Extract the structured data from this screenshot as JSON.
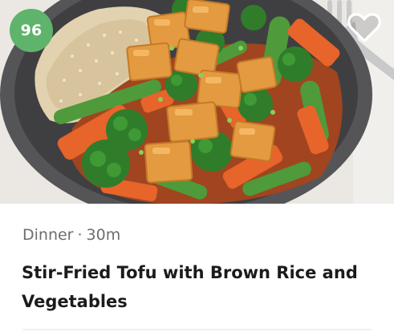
{
  "card": {
    "score": "96",
    "category": "Dinner",
    "separator": "·",
    "duration": "30m",
    "title": "Stir-Fried Tofu with Brown Rice and Vegetables",
    "image_subject": "Stir-fried tofu with brown rice, broccoli, carrots and snap peas on a dark grey plate",
    "icons": {
      "favorite": "heart-outline-icon",
      "utensil": "fork-icon"
    }
  },
  "colors": {
    "score_badge": "#5fb36a",
    "title_text": "#1b1b1b",
    "meta_text": "#6d6d6d"
  }
}
